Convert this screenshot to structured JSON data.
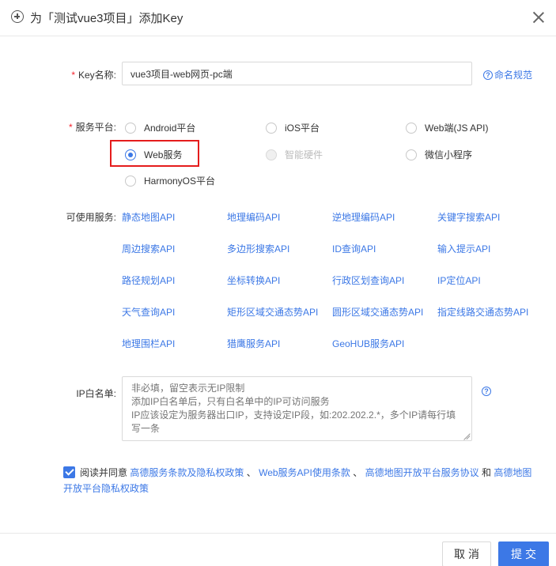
{
  "dialog": {
    "title": "为「测试vue3项目」添加Key"
  },
  "form": {
    "required_mark": "*",
    "key_name_label": "Key名称:",
    "key_name_value": "vue3项目-web网页-pc端",
    "naming_help": "命名规范",
    "platform_label": "服务平台:",
    "platforms": [
      {
        "label": "Android平台",
        "checked": false,
        "disabled": false
      },
      {
        "label": "iOS平台",
        "checked": false,
        "disabled": false
      },
      {
        "label": "Web端(JS API)",
        "checked": false,
        "disabled": false
      },
      {
        "label": "Web服务",
        "checked": true,
        "disabled": false
      },
      {
        "label": "智能硬件",
        "checked": false,
        "disabled": true
      },
      {
        "label": "微信小程序",
        "checked": false,
        "disabled": false
      },
      {
        "label": "HarmonyOS平台",
        "checked": false,
        "disabled": false
      }
    ],
    "services_label": "可使用服务:",
    "services": [
      "静态地图API",
      "地理编码API",
      "逆地理编码API",
      "关键字搜索API",
      "周边搜索API",
      "多边形搜索API",
      "ID查询API",
      "输入提示API",
      "路径规划API",
      "坐标转换API",
      "行政区划查询API",
      "IP定位API",
      "天气查询API",
      "矩形区域交通态势API",
      "圆形区域交通态势API",
      "指定线路交通态势API",
      "地理围栏API",
      "猎鹰服务API",
      "GeoHUB服务API"
    ],
    "ip_label": "IP白名单:",
    "ip_placeholder": "非必填，留空表示无IP限制\n添加IP白名单后，只有白名单中的IP可访问服务\nIP应该设定为服务器出口IP，支持设定IP段，如:202.202.2.*，多个IP请每行填写一条",
    "ip_help": "?"
  },
  "agreement": {
    "checked": true,
    "prefix": "阅读并同意",
    "link1": "高德服务条款及隐私权政策",
    "sep1": "、",
    "link2": "Web服务API使用条款",
    "sep2": "、",
    "link3": "高德地图开放平台服务协议",
    "conj": "和",
    "link4": "高德地图开放平台隐私权政策"
  },
  "footer": {
    "cancel_label": "取消",
    "submit_label": "提交"
  },
  "colors": {
    "accent": "#3c78e6",
    "required": "#f5222d",
    "highlight": "#e51c1c"
  }
}
